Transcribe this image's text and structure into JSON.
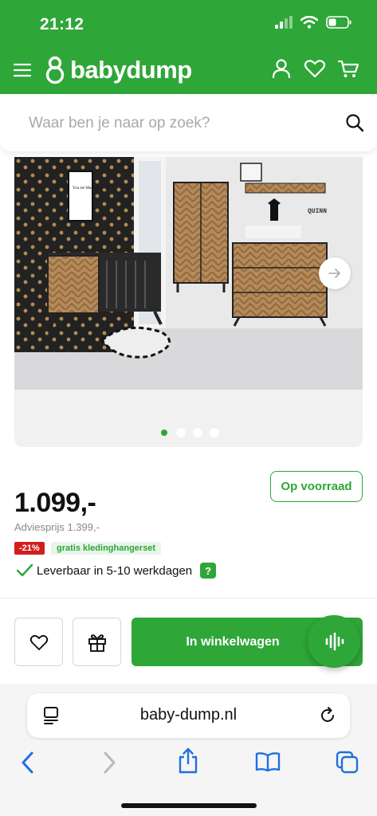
{
  "status_bar": {
    "time": "21:12"
  },
  "header": {
    "brand": "babydump",
    "icons": [
      "menu-icon",
      "logo-icon",
      "user-icon",
      "heart-icon",
      "cart-icon"
    ]
  },
  "search": {
    "placeholder": "Waar ben je naar op zoek?"
  },
  "gallery": {
    "image_label": "QUINN",
    "poster_text": "You are Made of magic",
    "slide_count": 4,
    "active_slide": 1
  },
  "product": {
    "stock_status": "Op voorraad",
    "price": "1.099,-",
    "advice_price": "Adviesprijs 1.399,-",
    "discount": "-21%",
    "promo": "gratis kledinghangerset",
    "delivery": "Leverbaar in 5-10 werkdagen",
    "help": "?"
  },
  "actions": {
    "add_to_cart": "In winkelwagen"
  },
  "browser": {
    "url": "baby-dump.nl"
  },
  "colors": {
    "brand_green": "#2ea638",
    "discount_red": "#d21d1d"
  }
}
